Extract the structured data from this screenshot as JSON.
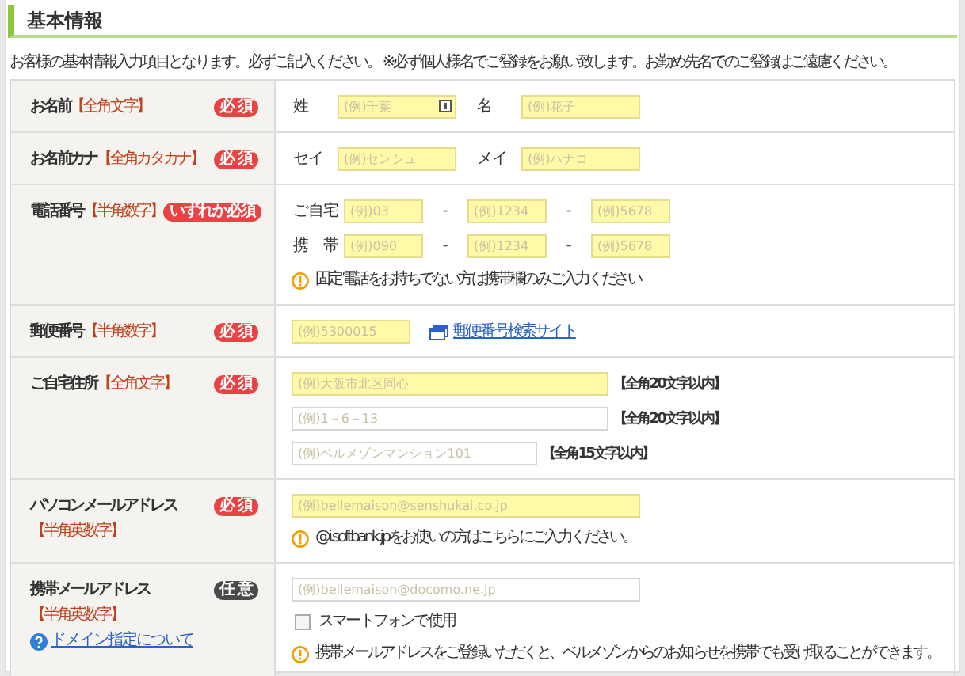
{
  "section_title": "基本情報",
  "intro": "お客様の基本情報入力項目となります。必ずご記入ください。 ※必ず個人様名でご登録をお願い致します。お勤め先名でのご登録はご遠慮ください。",
  "rows": [
    {
      "kind": "name",
      "label": "お名前",
      "hint": "【全角文字】",
      "badge": {
        "text": "必 須",
        "kind": "required"
      },
      "lines": [
        [
          {
            "kind": "caption",
            "text": "姓"
          },
          {
            "kind": "field",
            "placeholder": "(例)千葉",
            "highlighted": true,
            "ime_icon": true
          },
          {
            "kind": "caption",
            "text": "名"
          },
          {
            "kind": "field",
            "placeholder": "(例)花子",
            "highlighted": true
          }
        ]
      ]
    },
    {
      "kind": "name",
      "label": "お名前カナ",
      "hint": "【全角カタカナ】",
      "badge": {
        "text": "必 須",
        "kind": "required"
      },
      "lines": [
        [
          {
            "kind": "caption",
            "text": "セイ"
          },
          {
            "kind": "field",
            "placeholder": "(例)センシュ",
            "highlighted": true
          },
          {
            "kind": "caption",
            "text": "メイ"
          },
          {
            "kind": "field",
            "placeholder": "(例)ハナコ",
            "highlighted": true
          }
        ]
      ]
    },
    {
      "kind": "phone",
      "label": "電話番号",
      "hint": "【半角数字】",
      "badge": {
        "text": "いずれか必須",
        "kind": "required"
      },
      "lines": [
        [
          {
            "kind": "caption",
            "text": "ご自宅"
          },
          {
            "kind": "field",
            "placeholder": "(例)03",
            "highlighted": true
          },
          {
            "kind": "dash",
            "text": "-"
          },
          {
            "kind": "field",
            "placeholder": "(例)1234",
            "highlighted": true
          },
          {
            "kind": "dash",
            "text": "-"
          },
          {
            "kind": "field",
            "placeholder": "(例)5678",
            "highlighted": true
          }
        ],
        [
          {
            "kind": "caption",
            "text": "携　帯"
          },
          {
            "kind": "field",
            "placeholder": "(例)090",
            "highlighted": true
          },
          {
            "kind": "dash",
            "text": "-"
          },
          {
            "kind": "field",
            "placeholder": "(例)1234",
            "highlighted": true
          },
          {
            "kind": "dash",
            "text": "-"
          },
          {
            "kind": "field",
            "placeholder": "(例)5678",
            "highlighted": true
          }
        ],
        [
          {
            "kind": "note",
            "text": "固定電話をお持ちでない方は携帯欄のみご入力ください"
          }
        ]
      ]
    },
    {
      "kind": "postal",
      "label": "郵便番号",
      "hint": "【半角数字】",
      "badge": {
        "text": "必 須",
        "kind": "required"
      },
      "lines": [
        [
          {
            "kind": "field",
            "placeholder": "(例)5300015",
            "highlighted": true
          },
          {
            "kind": "link",
            "text": "郵便番号検索サイト"
          }
        ]
      ]
    },
    {
      "kind": "address",
      "label": "ご自宅住所",
      "hint": "【全角文字】",
      "badge": {
        "text": "必 須",
        "kind": "required"
      },
      "lines": [
        [
          {
            "kind": "field",
            "placeholder": "(例)大阪市北区同心",
            "highlighted": true
          },
          {
            "kind": "limit",
            "text": "【全角20文字以内】"
          }
        ],
        [
          {
            "kind": "field",
            "placeholder": "(例)1－6－13",
            "highlighted": false
          },
          {
            "kind": "limit",
            "text": "【全角20文字以内】"
          }
        ],
        [
          {
            "kind": "field",
            "placeholder": "(例)ベルメゾンマンション101",
            "highlighted": false
          },
          {
            "kind": "limit",
            "text": "【全角15文字以内】"
          }
        ]
      ]
    },
    {
      "kind": "email",
      "label": "パソコンメールアドレス",
      "hint": "【半角英数字】",
      "badge": {
        "text": "必 須",
        "kind": "required"
      },
      "lines": [
        [
          {
            "kind": "field",
            "placeholder": "(例)bellemaison@senshukai.co.jp",
            "highlighted": true
          }
        ],
        [
          {
            "kind": "note",
            "text": "@i.softbank.jpをお使いの方はこちらにご入力ください。"
          }
        ]
      ]
    },
    {
      "kind": "email",
      "label": "携帯メールアドレス",
      "hint": "【半角英数字】",
      "badge": {
        "text": "任 意",
        "kind": "optional"
      },
      "help_link": "ドメイン指定について",
      "lines": [
        [
          {
            "kind": "field",
            "placeholder": "(例)bellemaison@docomo.ne.jp",
            "highlighted": false
          }
        ],
        [
          {
            "kind": "checkbox",
            "text": "スマートフォンで使用",
            "checked": false
          }
        ],
        [
          {
            "kind": "note",
            "text": "携帯メールアドレスをご登録いただくと、ベルメゾンからのお知らせを携帯でも受け取ることができます。"
          }
        ]
      ]
    }
  ]
}
